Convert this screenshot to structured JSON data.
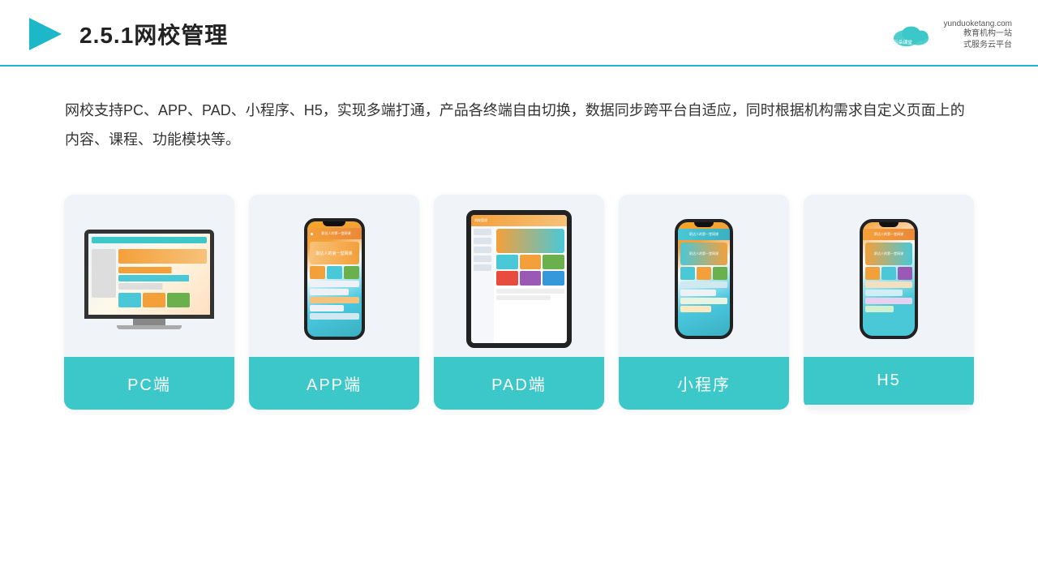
{
  "header": {
    "title": "2.5.1网校管理",
    "brand": {
      "name": "云朵课堂",
      "url": "yunduoketang.com",
      "slogan": "教育机构一站\n式服务云平台"
    }
  },
  "description": "网校支持PC、APP、PAD、小程序、H5，实现多端打通，产品各终端自由切换，数据同步跨平台自适应，同时根据机构需求自定义页面上的内容、课程、功能模块等。",
  "cards": [
    {
      "id": "pc",
      "label": "PC端"
    },
    {
      "id": "app",
      "label": "APP端"
    },
    {
      "id": "pad",
      "label": "PAD端"
    },
    {
      "id": "miniapp",
      "label": "小程序"
    },
    {
      "id": "h5",
      "label": "H5"
    }
  ],
  "colors": {
    "teal": "#3cc8c8",
    "accent_orange": "#f4a03a",
    "header_border": "#1cb8c8"
  }
}
